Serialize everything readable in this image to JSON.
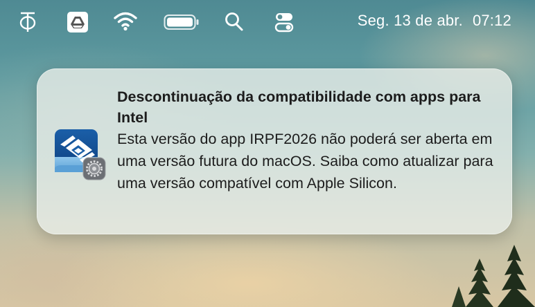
{
  "menubar": {
    "icons": [
      "phi-icon",
      "google-drive-icon",
      "wifi-icon",
      "battery-icon",
      "search-icon",
      "control-center-icon"
    ],
    "date": "Seg. 13 de abr.",
    "time": "07:12"
  },
  "notification": {
    "app_icon": "irpf-app-icon",
    "badge_icon": "gear-icon",
    "title": "Descontinuação da compatibilidade com apps para Intel",
    "body": "Esta versão do app IRPF2026 não poderá ser aberta em uma versão futura do macOS. Saiba como atualizar para uma versão compatível com Apple Silicon."
  }
}
